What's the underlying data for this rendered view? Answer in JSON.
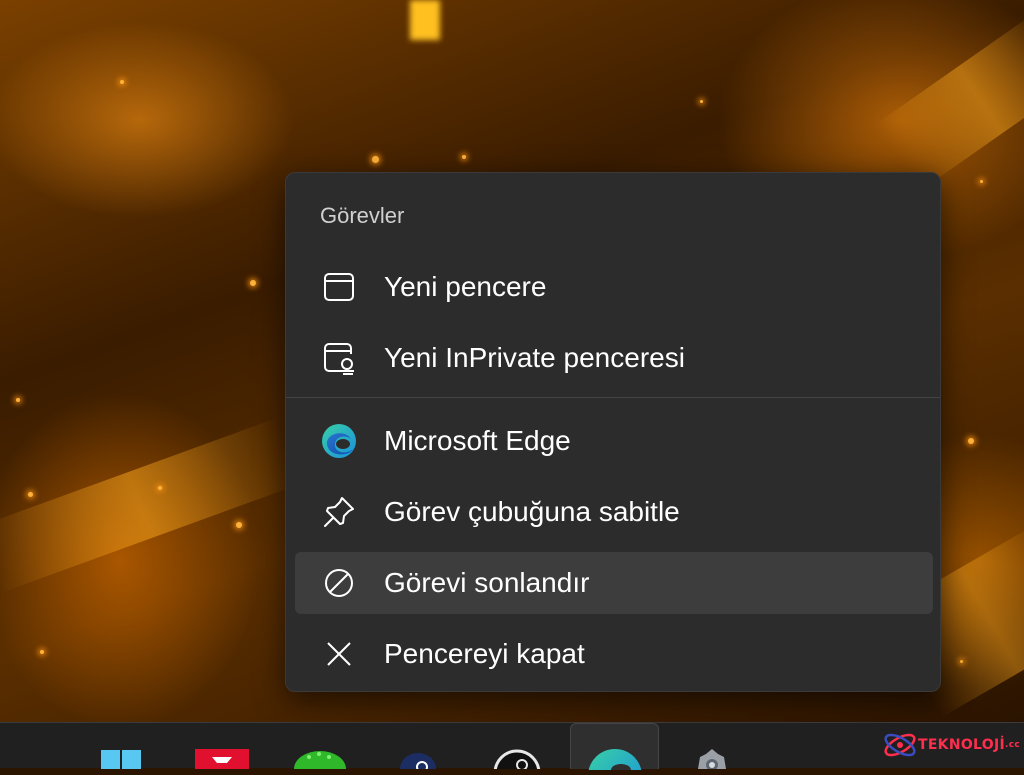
{
  "menu": {
    "header": "Görevler",
    "items": [
      {
        "label": "Yeni pencere",
        "icon": "window-icon"
      },
      {
        "label": "Yeni InPrivate penceresi",
        "icon": "inprivate-window-icon"
      },
      {
        "label": "Microsoft Edge",
        "icon": "edge-icon"
      },
      {
        "label": "Görev çubuğuna sabitle",
        "icon": "pin-icon"
      },
      {
        "label": "Görevi sonlandır",
        "icon": "end-task-icon",
        "highlighted": true
      },
      {
        "label": "Pencereyi kapat",
        "icon": "close-icon"
      }
    ]
  },
  "taskbar": {
    "apps": [
      "start-icon",
      "red-app-icon",
      "green-app-icon",
      "media-player-icon",
      "steam-icon",
      "edge-icon",
      "settings-icon"
    ],
    "active_app": "edge-icon"
  },
  "watermark": {
    "text": "TEKNOLOJİ",
    "suffix": ".cc",
    "color": "#ff2e4d"
  },
  "colors": {
    "menu_bg": "#2c2c2c",
    "highlight_bg": "#3d3d3d",
    "taskbar_bg": "#202020",
    "wallpaper_accent": "#ff9a10"
  }
}
